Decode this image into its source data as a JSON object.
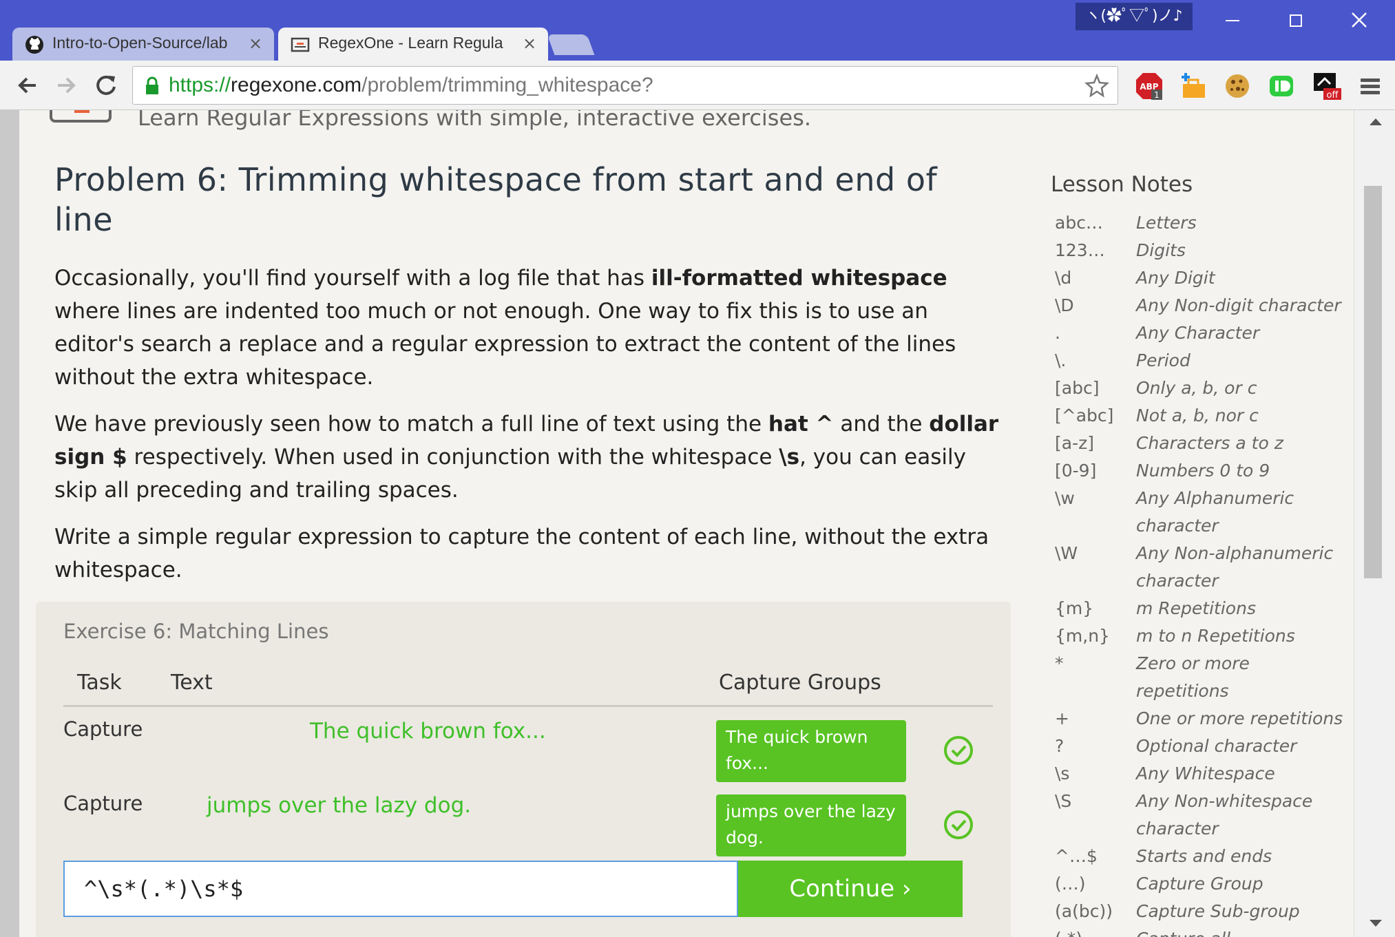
{
  "window": {
    "emoticon": "ヽ(✿ﾟ▽ﾟ)ノ♪"
  },
  "tabs": [
    {
      "title": "Intro-to-Open-Source/lab",
      "active": false,
      "icon": "github-icon"
    },
    {
      "title": "RegexOne - Learn Regular",
      "active": true,
      "icon": "regexone-icon"
    }
  ],
  "address_bar": {
    "scheme": "https://",
    "host": "regexone.com",
    "path": "/problem/trimming_whitespace?"
  },
  "extensions": {
    "abp_badge": "1",
    "abp_label": "ABP",
    "off_label": "off"
  },
  "header": {
    "tagline": "Learn Regular Expressions with simple, interactive exercises."
  },
  "problem": {
    "title": "Problem 6: Trimming whitespace from start and end of line",
    "p1_a": "Occasionally, you'll find yourself with a log file that has ",
    "p1_b": "ill-formatted whitespace",
    "p1_c": " where lines are indented too much or not enough. One way to fix this is to use an editor's search a replace and a regular expression to extract the content of the lines without the extra whitespace.",
    "p2_a": "We have previously seen how to match a full line of text using the ",
    "p2_b": "hat ^",
    "p2_c": " and the ",
    "p2_d": "dollar sign $",
    "p2_e": " respectively. When used in conjunction with the whitespace ",
    "p2_f": "\\s",
    "p2_g": ", you can easily skip all preceding and trailing spaces.",
    "p3": "Write a simple regular expression to capture the content of each line, without the extra whitespace."
  },
  "exercise": {
    "title": "Exercise 6: Matching Lines",
    "col_task": "Task",
    "col_text": "Text",
    "col_groups": "Capture Groups",
    "rows": [
      {
        "task": "Capture",
        "text": "The quick brown fox...",
        "group": "The quick brown fox..."
      },
      {
        "task": "Capture",
        "text": "jumps over the lazy dog.",
        "group": "jumps over the lazy dog."
      }
    ],
    "input_value": "^\\s*(.*)\\s*$",
    "continue_label": "Continue ›"
  },
  "lesson_notes": {
    "title": "Lesson Notes",
    "items": [
      {
        "key": "abc…",
        "desc": "Letters"
      },
      {
        "key": "123…",
        "desc": "Digits"
      },
      {
        "key": "\\d",
        "desc": "Any Digit"
      },
      {
        "key": "\\D",
        "desc": "Any Non-digit character"
      },
      {
        "key": ".",
        "desc": "Any Character"
      },
      {
        "key": "\\.",
        "desc": "Period"
      },
      {
        "key": "[abc]",
        "desc": "Only a, b, or c"
      },
      {
        "key": "[^abc]",
        "desc": "Not a, b, nor c"
      },
      {
        "key": "[a-z]",
        "desc": "Characters a to z"
      },
      {
        "key": "[0-9]",
        "desc": "Numbers 0 to 9"
      },
      {
        "key": "\\w",
        "desc": "Any Alphanumeric character"
      },
      {
        "key": "\\W",
        "desc": "Any Non-alphanumeric character"
      },
      {
        "key": "{m}",
        "desc": "m Repetitions"
      },
      {
        "key": "{m,n}",
        "desc": "m to n Repetitions"
      },
      {
        "key": "*",
        "desc": "Zero or more repetitions"
      },
      {
        "key": "+",
        "desc": "One or more repetitions"
      },
      {
        "key": "?",
        "desc": "Optional character"
      },
      {
        "key": "\\s",
        "desc": "Any Whitespace"
      },
      {
        "key": "\\S",
        "desc": "Any Non-whitespace character"
      },
      {
        "key": "^…$",
        "desc": "Starts and ends"
      },
      {
        "key": "(…)",
        "desc": "Capture Group"
      },
      {
        "key": "(a(bc))",
        "desc": "Capture Sub-group"
      },
      {
        "key": "(.*)",
        "desc": "Capture all"
      }
    ]
  },
  "colors": {
    "chrome_frame": "#4a56cc",
    "accent_green": "#58c323",
    "match_text_green": "#3fbf2a",
    "page_background": "#f4f3ef"
  }
}
